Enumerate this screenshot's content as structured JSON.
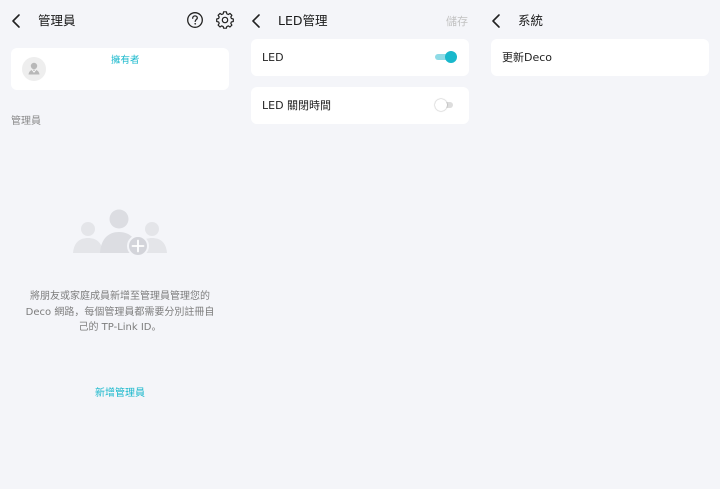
{
  "colors": {
    "accent": "#19b8cc",
    "background": "#f4f5f9",
    "card": "#ffffff",
    "muted_text": "#7d7d7d"
  },
  "admin_panel": {
    "title": "管理員",
    "icons": [
      "back-icon",
      "help-icon",
      "gear-icon"
    ],
    "owner_badge": "擁有者",
    "section_label": "管理員",
    "empty_message": "將朋友或家庭成員新增至管理員管理您的 Deco 網路，每個管理員都需要分別註冊自己的 TP-Link ID。",
    "add_link": "新增管理員"
  },
  "led_panel": {
    "title": "LED管理",
    "save_label": "儲存",
    "rows": [
      {
        "label": "LED",
        "toggle": true
      },
      {
        "label": "LED 關閉時間",
        "toggle": false
      }
    ]
  },
  "system_panel": {
    "title": "系統",
    "items": [
      {
        "label": "更新Deco"
      }
    ]
  }
}
